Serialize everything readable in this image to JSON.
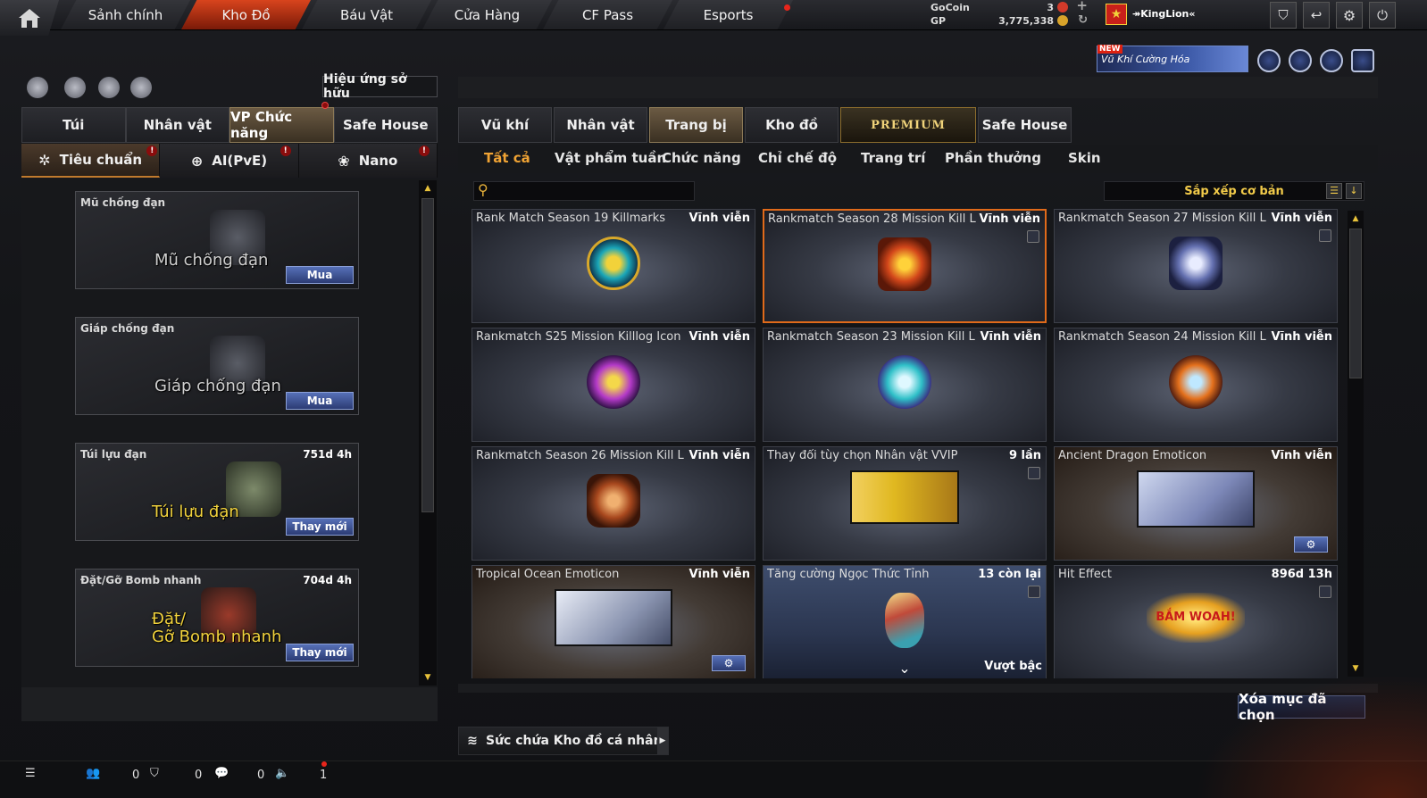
{
  "topnav": {
    "tabs": [
      "Sảnh chính",
      "Kho Đồ",
      "Báu Vật",
      "Cửa Hàng",
      "CF Pass",
      "Esports"
    ],
    "active_index": 1
  },
  "currency": {
    "gocoin_label": "GoCoin",
    "gocoin_value": "3",
    "gp_label": "GP",
    "gp_value": "3,775,338"
  },
  "player": {
    "name": "↠KingLion«"
  },
  "banner": {
    "new_label": "NEW",
    "text": "Vũ Khí Cường Hóa"
  },
  "left": {
    "effect_button": "Hiệu ứng sở hữu",
    "tabs": [
      "Túi",
      "Nhân vật",
      "VP Chức năng",
      "Safe House"
    ],
    "active_tab": 2,
    "subtabs": [
      "Tiêu chuẩn",
      "AI(PvE)",
      "Nano"
    ],
    "slots": [
      {
        "title": "Mũ chống đạn",
        "duration": "",
        "big": "Mũ chống đạn",
        "button": "Mua"
      },
      {
        "title": "Giáp chống đạn",
        "duration": "",
        "big": "Giáp chống đạn",
        "button": "Mua"
      },
      {
        "title": "Túi lựu đạn",
        "duration": "751d 4h",
        "big": "Túi lựu đạn",
        "button": "Thay mới"
      },
      {
        "title": "Đặt/Gỡ Bomb nhanh",
        "duration": "704d 4h",
        "big_line1": "Đặt/",
        "big_line2": "Gỡ Bomb nhanh",
        "button": "Thay mới"
      }
    ]
  },
  "right": {
    "tabs": [
      "Vũ khí",
      "Nhân vật",
      "Trang bị",
      "Kho đồ",
      "PREMIUM",
      "Safe House"
    ],
    "active_tab": 2,
    "subtabs": [
      "Tất cả",
      "Vật phẩm tuần",
      "Chức năng",
      "Chỉ chế độ",
      "Trang trí",
      "Phần thưởng",
      "Skin"
    ],
    "sort_label": "Sắp xếp cơ bản",
    "items": [
      {
        "name": "Rank Match Season 19 Killmarks",
        "duration": "Vĩnh viễn",
        "color": "#1aa6b8"
      },
      {
        "name": "Rankmatch Season 28 Mission Kill L",
        "duration": "Vĩnh viễn",
        "color": "#d2461a"
      },
      {
        "name": "Rankmatch Season 27 Mission Kill L",
        "duration": "Vĩnh viễn",
        "color": "#6470b0"
      },
      {
        "name": "Rankmatch S25 Mission Killlog Icon",
        "duration": "Vĩnh viễn",
        "color": "#b43ac8"
      },
      {
        "name": "Rankmatch Season 23 Mission Kill L",
        "duration": "Vĩnh viễn",
        "color": "#2fc0c8"
      },
      {
        "name": "Rankmatch Season 24 Mission Kill L",
        "duration": "Vĩnh viễn",
        "color": "#e4701c"
      },
      {
        "name": "Rankmatch Season 26 Mission Kill L",
        "duration": "Vĩnh viễn",
        "color": "#a8481e"
      },
      {
        "name": "Thay đổi tùy chọn Nhân vật VVIP",
        "duration": "9 lần",
        "color": "#e0b820"
      },
      {
        "name": "Ancient Dragon Emoticon",
        "duration": "Vĩnh viễn",
        "color": "#7d88b8"
      },
      {
        "name": "Tropical Ocean Emoticon",
        "duration": "Vĩnh viễn",
        "color": "#8a94b0"
      },
      {
        "name": "Tăng cường Ngọc Thức Tỉnh",
        "duration": "13 còn lại",
        "color": "#c04a3a",
        "tag": "Vượt bậc"
      },
      {
        "name": "Hit Effect",
        "duration": "896d 13h",
        "color": "#e6a020",
        "art_text": "BẮM WOAH!"
      }
    ],
    "delete_button": "Xóa mục đã chọn",
    "capacity_label": "Sức chứa Kho đồ cá nhân"
  },
  "bottombar": {
    "c1": "0",
    "c2": "0",
    "c3": "0",
    "c4": "1"
  }
}
